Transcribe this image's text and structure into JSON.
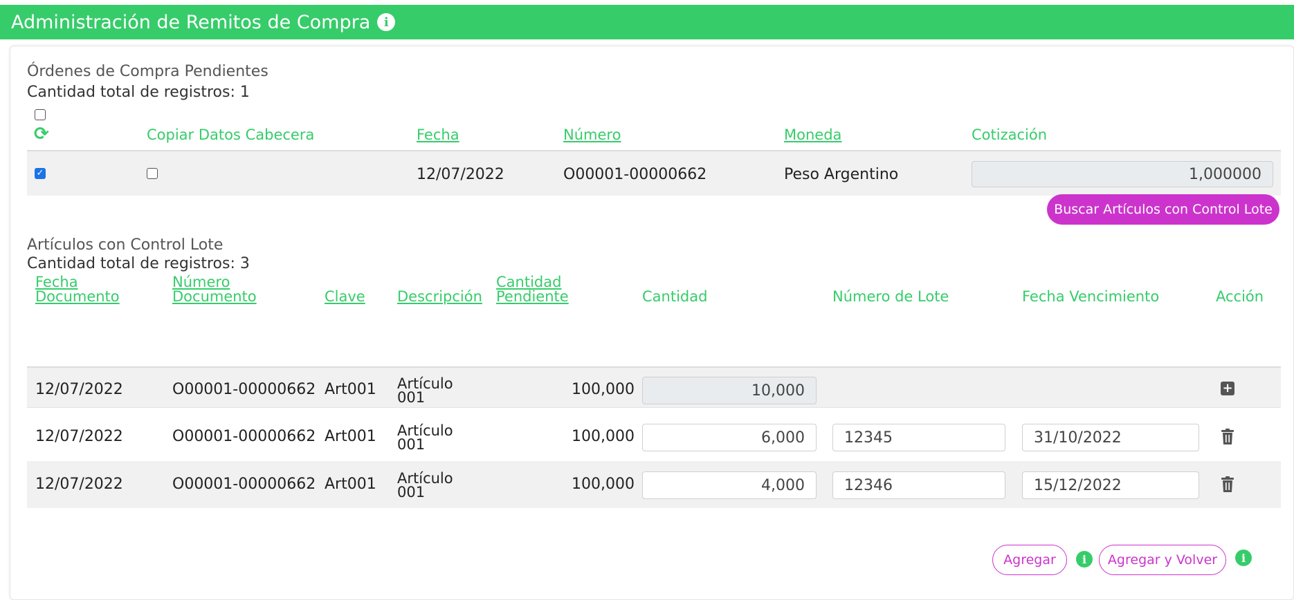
{
  "header": {
    "title": "Administración de Remitos de Compra"
  },
  "orders": {
    "title": "Órdenes de Compra Pendientes",
    "count_label": "Cantidad total de registros: 1",
    "columns": {
      "copy": "Copiar Datos Cabecera",
      "date": "Fecha",
      "number": "Número",
      "currency": "Moneda",
      "rate": "Cotización"
    },
    "rows": [
      {
        "selected": true,
        "copy_header": false,
        "date": "12/07/2022",
        "number": "O00001-00000662",
        "currency": "Peso Argentino",
        "rate": "1,000000"
      }
    ]
  },
  "search_button": "Buscar Artículos con Control Lote",
  "articles": {
    "title": "Artículos con Control Lote",
    "count_label": "Cantidad total de registros: 3",
    "columns": {
      "doc_date_1": "Fecha",
      "doc_date_2": "Documento",
      "doc_number_1": "Número",
      "doc_number_2": "Documento",
      "key": "Clave",
      "description": "Descripción",
      "pending_1": "Cantidad",
      "pending_2": "Pendiente",
      "quantity": "Cantidad",
      "lot_number": "Número de Lote",
      "expiry": "Fecha Vencimiento",
      "action": "Acción"
    },
    "rows": [
      {
        "doc_date": "12/07/2022",
        "doc_number": "O00001-00000662",
        "key": "Art001",
        "desc_1": "Artículo",
        "desc_2": "001",
        "pending": "100,000",
        "quantity": "10,000",
        "lot": "",
        "expiry": "",
        "action": "add"
      },
      {
        "doc_date": "12/07/2022",
        "doc_number": "O00001-00000662",
        "key": "Art001",
        "desc_1": "Artículo",
        "desc_2": "001",
        "pending": "100,000",
        "quantity": "6,000",
        "lot": "12345",
        "expiry": "31/10/2022",
        "action": "delete"
      },
      {
        "doc_date": "12/07/2022",
        "doc_number": "O00001-00000662",
        "key": "Art001",
        "desc_1": "Artículo",
        "desc_2": "001",
        "pending": "100,000",
        "quantity": "4,000",
        "lot": "12346",
        "expiry": "15/12/2022",
        "action": "delete"
      }
    ]
  },
  "footer": {
    "add": "Agregar",
    "add_back": "Agregar y Volver"
  },
  "colors": {
    "brand_green": "#36cc6a",
    "accent_magenta": "#cc33cc"
  }
}
